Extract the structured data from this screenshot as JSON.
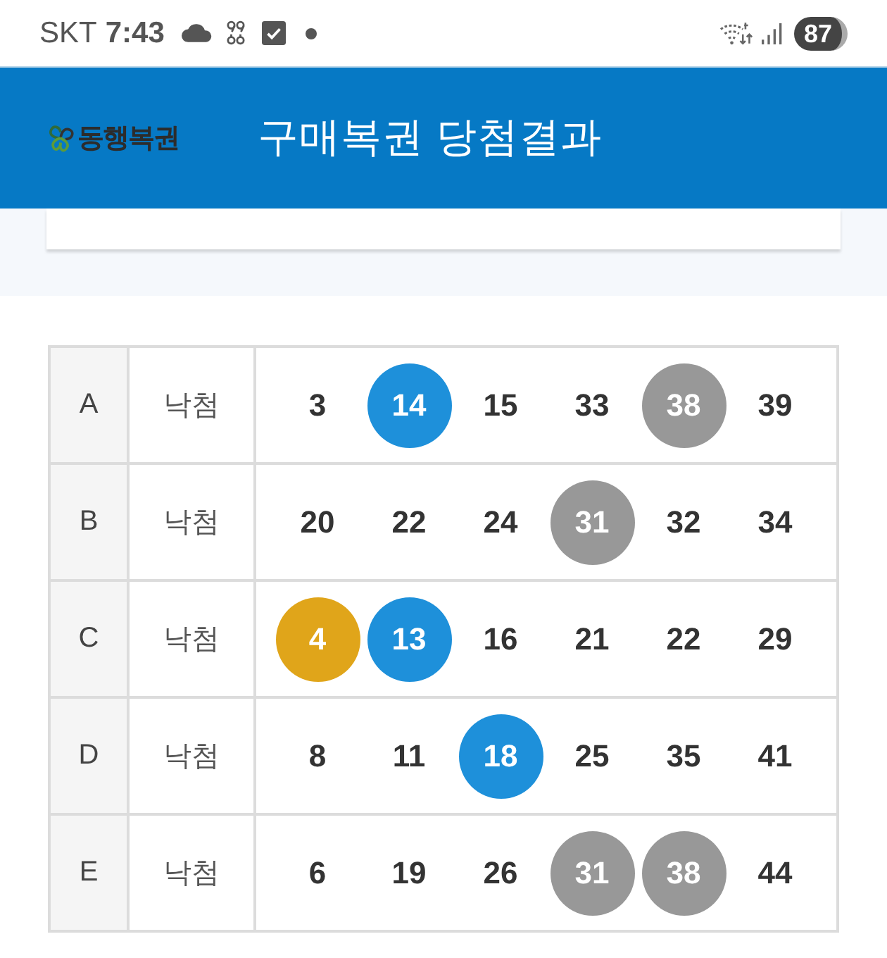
{
  "status_bar": {
    "carrier": "SKT",
    "time": "7:43",
    "battery": "87"
  },
  "header": {
    "logo_text": "동행복권",
    "title": "구매복권 당첨결과"
  },
  "results": [
    {
      "game": "A",
      "result": "낙첨",
      "numbers": [
        {
          "value": "3"
        },
        {
          "value": "14",
          "color": "#1e90da"
        },
        {
          "value": "15"
        },
        {
          "value": "33"
        },
        {
          "value": "38",
          "color": "#989898"
        },
        {
          "value": "39"
        }
      ]
    },
    {
      "game": "B",
      "result": "낙첨",
      "numbers": [
        {
          "value": "20"
        },
        {
          "value": "22"
        },
        {
          "value": "24"
        },
        {
          "value": "31",
          "color": "#989898"
        },
        {
          "value": "32"
        },
        {
          "value": "34"
        }
      ]
    },
    {
      "game": "C",
      "result": "낙첨",
      "numbers": [
        {
          "value": "4",
          "color": "#e0a51a"
        },
        {
          "value": "13",
          "color": "#1e90da"
        },
        {
          "value": "16"
        },
        {
          "value": "21"
        },
        {
          "value": "22"
        },
        {
          "value": "29"
        }
      ]
    },
    {
      "game": "D",
      "result": "낙첨",
      "numbers": [
        {
          "value": "8"
        },
        {
          "value": "11"
        },
        {
          "value": "18",
          "color": "#1e90da"
        },
        {
          "value": "25"
        },
        {
          "value": "35"
        },
        {
          "value": "41"
        }
      ]
    },
    {
      "game": "E",
      "result": "낙첨",
      "numbers": [
        {
          "value": "6"
        },
        {
          "value": "19"
        },
        {
          "value": "26"
        },
        {
          "value": "31",
          "color": "#989898"
        },
        {
          "value": "38",
          "color": "#989898"
        },
        {
          "value": "44"
        }
      ]
    }
  ]
}
